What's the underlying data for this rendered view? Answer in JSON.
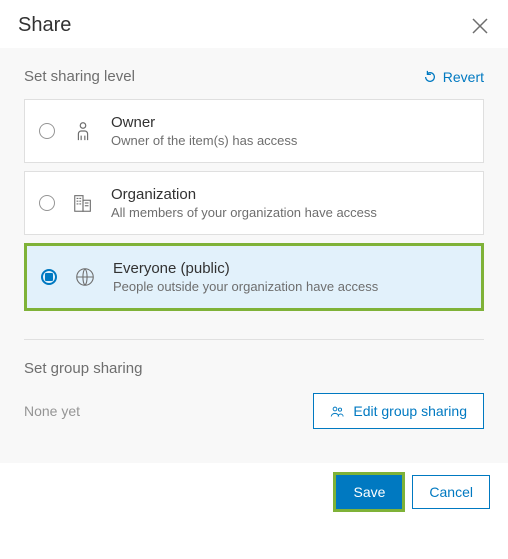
{
  "header": {
    "title": "Share"
  },
  "sharingLevel": {
    "title": "Set sharing level",
    "revertLabel": "Revert",
    "options": [
      {
        "label": "Owner",
        "desc": "Owner of the item(s) has access",
        "selected": false
      },
      {
        "label": "Organization",
        "desc": "All members of your organization have access",
        "selected": false
      },
      {
        "label": "Everyone (public)",
        "desc": "People outside your organization have access",
        "selected": true
      }
    ]
  },
  "groupSharing": {
    "title": "Set group sharing",
    "noneLabel": "None yet",
    "editLabel": "Edit group sharing"
  },
  "footer": {
    "saveLabel": "Save",
    "cancelLabel": "Cancel"
  }
}
